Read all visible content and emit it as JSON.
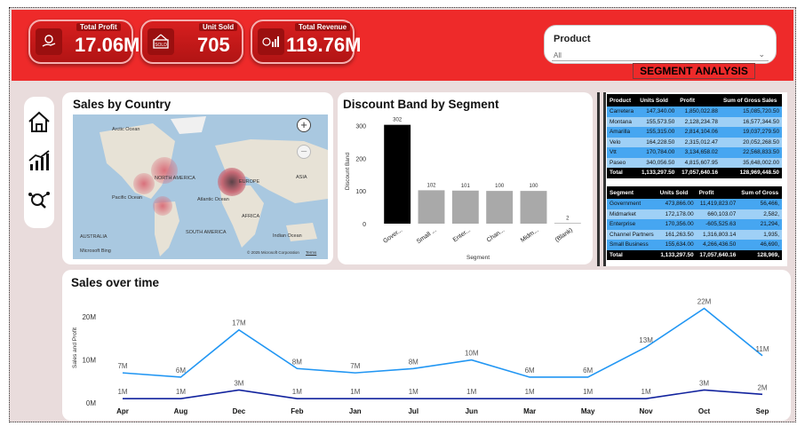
{
  "kpis": [
    {
      "label": "Total Profit",
      "value": "17.06M",
      "icon": "money-hand-icon"
    },
    {
      "label": "Unit Sold",
      "value": "705",
      "icon": "sold-sign-icon"
    },
    {
      "label": "Total Revenue",
      "value": "119.76M",
      "icon": "revenue-chart-icon"
    }
  ],
  "filter": {
    "title": "Product",
    "value": "All"
  },
  "segment_button": "SEGMENT ANALYSIS",
  "nav": {
    "home": "home-icon",
    "chart": "chart-icon",
    "analysis": "analysis-icon"
  },
  "map": {
    "title": "Sales by Country",
    "labels": {
      "arctic": "Arctic Ocean",
      "north_america": "NORTH AMERICA",
      "europe": "EUROPE",
      "asia": "ASIA",
      "pacific": "Pacific Ocean",
      "atlantic": "Atlantic Ocean",
      "africa": "AFRICA",
      "south_america": "SOUTH AMERICA",
      "indian": "Indian Ocean",
      "australia": "AUSTRALIA",
      "copyright": "© 2025 Microsoft Corporation",
      "terms": "Terms",
      "logo": "Microsoft Bing"
    },
    "zoom_in": "+",
    "zoom_out": "−"
  },
  "product_table": {
    "headers": [
      "Product",
      "Units Sold",
      "Profit",
      "Sum of Gross Sales"
    ],
    "rows": [
      [
        "Carretera",
        "147,340.00",
        "1,850,022.88",
        "15,085,720.50"
      ],
      [
        "Montana",
        "155,573.50",
        "2,128,234.78",
        "16,577,344.50"
      ],
      [
        "Amarilla",
        "155,315.00",
        "2,814,104.06",
        "19,037,279.50"
      ],
      [
        "Velo",
        "164,228.50",
        "2,315,012.47",
        "20,052,268.50"
      ],
      [
        "Vtt",
        "170,784.00",
        "3,134,658.02",
        "22,568,833.50"
      ],
      [
        "Paseo",
        "340,056.50",
        "4,815,607.95",
        "35,648,002.00"
      ]
    ],
    "total": [
      "Total",
      "1,133,297.50",
      "17,057,640.16",
      "128,969,448.50"
    ]
  },
  "segment_table": {
    "headers": [
      "Segment",
      "Units Sold",
      "Profit",
      "Sum of Gross"
    ],
    "rows": [
      [
        "Government",
        "473,866.00",
        "11,419,823.07",
        "56,466,"
      ],
      [
        "Midmarket",
        "172,178.00",
        "660,103.07",
        "2,582,"
      ],
      [
        "Enterprise",
        "170,356.00",
        "-605,525.63",
        "21,294,"
      ],
      [
        "Channel Partners",
        "161,263.50",
        "1,316,803.14",
        "1,935,"
      ],
      [
        "Small Business",
        "155,634.00",
        "4,266,436.50",
        "46,690,"
      ]
    ],
    "total": [
      "Total",
      "1,133,297.50",
      "17,057,640.16",
      "128,969,"
    ]
  },
  "chart_data": [
    {
      "type": "bar",
      "title": "Discount Band by Segment",
      "xlabel": "Segment",
      "ylabel": "Discount Band",
      "categories": [
        "Gover...",
        "Small ...",
        "Enter...",
        "Chan...",
        "Midm...",
        "(Blank)"
      ],
      "values": [
        302,
        102,
        101,
        100,
        100,
        2
      ],
      "data_labels": [
        "302",
        "102",
        "101",
        "100",
        "100",
        "2"
      ],
      "yticks": [
        "0",
        "100",
        "200",
        "300"
      ],
      "ylim": [
        0,
        320
      ],
      "colors": {
        "highlight": "#000000",
        "default": "#a9a9a9"
      }
    },
    {
      "type": "line",
      "title": "Sales over time",
      "ylabel": "Sales and Profit",
      "x": [
        "Apr",
        "Aug",
        "Dec",
        "Feb",
        "Jan",
        "Jul",
        "Jun",
        "Mar",
        "May",
        "Nov",
        "Oct",
        "Sep"
      ],
      "yticks": [
        "0M",
        "10M",
        "20M"
      ],
      "ylim": [
        0,
        25
      ],
      "series": [
        {
          "values": [
            7,
            6,
            17,
            8,
            7,
            8,
            10,
            6,
            6,
            13,
            22,
            11
          ],
          "labels": [
            "7M",
            "6M",
            "17M",
            "8M",
            "7M",
            "8M",
            "10M",
            "6M",
            "6M",
            "13M",
            "22M",
            "11M"
          ],
          "color": "#2196f3"
        },
        {
          "values": [
            1,
            1,
            3,
            1,
            1,
            1,
            1,
            1,
            1,
            1,
            3,
            2
          ],
          "labels": [
            "1M",
            "1M",
            "3M",
            "1M",
            "1M",
            "1M",
            "1M",
            "1M",
            "1M",
            "1M",
            "3M",
            "2M"
          ],
          "color": "#12239e"
        }
      ]
    }
  ]
}
